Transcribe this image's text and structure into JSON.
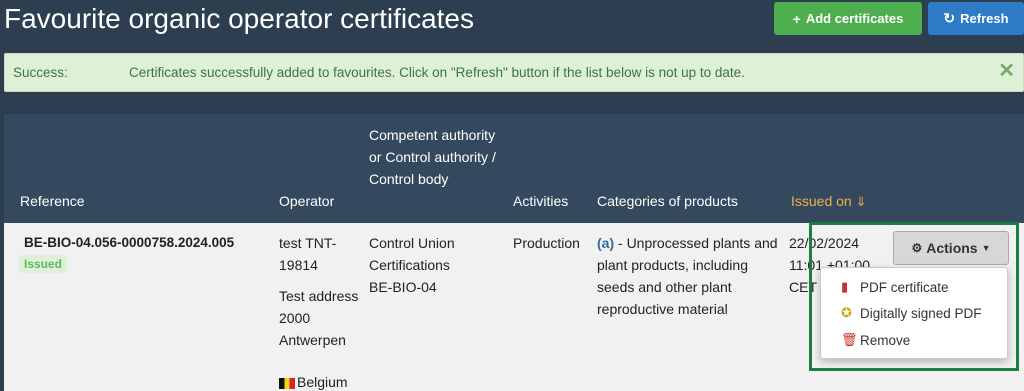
{
  "page": {
    "title": "Favourite organic operator certificates"
  },
  "toolbar": {
    "add_label": "Add certificates",
    "add_icon": "plus-icon",
    "refresh_label": "Refresh",
    "refresh_icon": "refresh-icon"
  },
  "alert": {
    "label": "Success:",
    "message": "Certificates successfully added to favourites. Click on \"Refresh\" button if the list below is not up to date.",
    "close_icon": "close-icon"
  },
  "table": {
    "headers": {
      "reference": "Reference",
      "operator": "Operator",
      "authority": "Competent authority or Control authority / Control body",
      "activities": "Activities",
      "categories": "Categories of products",
      "issued_on": "Issued on"
    },
    "rows": [
      {
        "reference": "BE-BIO-04.056-0000758.2024.005",
        "status": "Issued",
        "operator_name": "test TNT-19814",
        "operator_address": "Test address 2000 Antwerpen",
        "operator_country": "Belgium",
        "authority_name": "Control Union Certifications",
        "authority_code": "BE-BIO-04",
        "activity": "Production",
        "category_code": "(a)",
        "category_text": "- Unprocessed plants and plant products, including seeds and other plant reproductive material",
        "issued_date": "22/02/2024",
        "issued_time": "11:01 +01:00",
        "issued_tz": "CET"
      }
    ]
  },
  "actions": {
    "button_label": "Actions",
    "menu": [
      {
        "label": "PDF certificate",
        "icon": "pdf-file-icon"
      },
      {
        "label": "Digitally signed PDF",
        "icon": "certificate-badge-icon"
      },
      {
        "label": "Remove",
        "icon": "trash-icon"
      }
    ]
  },
  "colors": {
    "background": "#2c3e50",
    "header_bg": "#34495e",
    "add_button": "#4cae4c",
    "refresh_button": "#2e7cc7",
    "alert_bg": "#dff0d8",
    "alert_text": "#3c763d",
    "sorted_header": "#f0ad4e",
    "highlight_border": "#1b7f44"
  }
}
